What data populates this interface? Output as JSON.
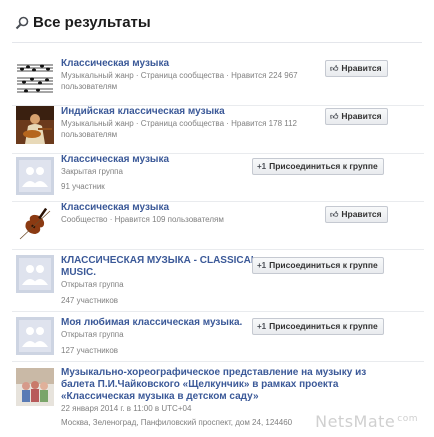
{
  "header": {
    "title": "Все результаты",
    "icon": "search-icon"
  },
  "results": [
    {
      "name": "Классическая музыка",
      "meta": [
        "Музыкальный жанр · Страница сообщества · Нравится 224 967",
        "пользователям"
      ],
      "button": "Нравится",
      "button_icon": "thumbs-up-icon"
    },
    {
      "name": "Индийская классическая музыка",
      "meta": [
        "Музыкальный жанр · Страница сообщества · Нравится 178 112",
        "пользователям"
      ],
      "button": "Нравится",
      "button_icon": "thumbs-up-icon"
    },
    {
      "name": "Классическая музыка",
      "meta": [
        "Закрытая группа",
        "91 участник"
      ],
      "button": "Присоединиться к группе",
      "button_icon": "plus-one-icon"
    },
    {
      "name": "Классическая музыка",
      "meta": [
        "Сообщество · Нравится 109 пользователям"
      ],
      "button": "Нравится",
      "button_icon": "thumbs-up-icon"
    },
    {
      "name": [
        "КЛАССИЧЕСКАЯ МУЗЫКА - CLASSICAL",
        "MUSIC."
      ],
      "meta": [
        "Открытая группа",
        "247 участников"
      ],
      "button": "Присоединиться к группе",
      "button_icon": "plus-one-icon"
    },
    {
      "name": "Моя любимая классическая музыка.",
      "meta": [
        "Открытая группа",
        "127 участников"
      ],
      "button": "Присоединиться к группе",
      "button_icon": "plus-one-icon"
    },
    {
      "name": [
        "Музыкально-хореографическое представление на музыку из",
        "балета П.И.Чайковского «Щелкунчик» в рамках проекта",
        "«Классическая музыка в детском саду»"
      ],
      "meta": [
        "22 января 2014 г. в 11:00 в UTC+04",
        "Москва, Зеленоград, Панфиловский проспект, дом 24, 124460"
      ]
    }
  ],
  "watermark": {
    "text": "NetsMate",
    "suffix": "com"
  },
  "colors": {
    "link": "#3b5998",
    "meta": "#808080",
    "button_bg": "#f0f1f3",
    "button_border": "#c5c9d1"
  }
}
